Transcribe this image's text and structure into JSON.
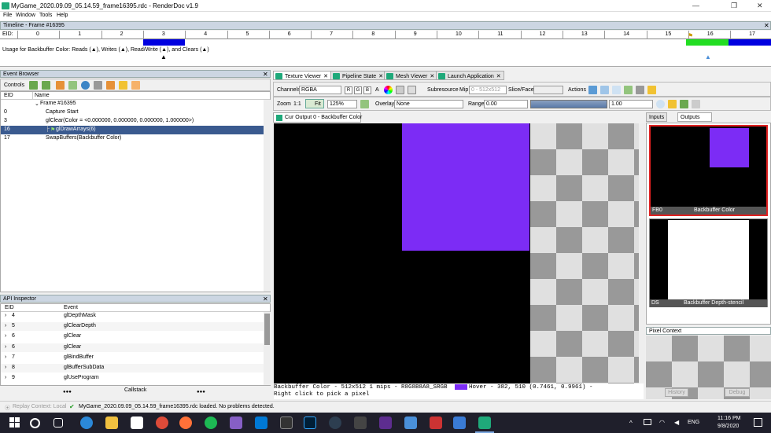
{
  "window": {
    "title": "MyGame_2020.09.09_05.14.59_frame16395.rdc - RenderDoc v1.9",
    "minimize": "—",
    "maximize": "❐",
    "close": "✕"
  },
  "menu": [
    "File",
    "Window",
    "Tools",
    "Help"
  ],
  "timeline": {
    "header": "Timeline - Frame #16395",
    "eid_label": "EID:",
    "ticks": [
      "0",
      "1",
      "2",
      "3",
      "4",
      "5",
      "6",
      "7",
      "8",
      "9",
      "10",
      "11",
      "12",
      "13",
      "14",
      "15",
      "16",
      "17"
    ],
    "usage": "Usage for Backbuffer Color: Reads (▲), Writes (▲), Read/Write (▲), and Clears (▲)"
  },
  "event_browser": {
    "header": "Event Browser",
    "controls_label": "Controls",
    "columns": [
      "EID",
      "Name"
    ],
    "rows": [
      {
        "eid": "",
        "name": "Frame #16395",
        "indent": 1
      },
      {
        "eid": "0",
        "name": "Capture Start",
        "indent": 2
      },
      {
        "eid": "3",
        "name": "glClear(Color = <0.000000, 0.000000, 0.000000, 1.000000>)",
        "indent": 2
      },
      {
        "eid": "16",
        "name": "glDrawArrays(6)",
        "indent": 2,
        "selected": true
      },
      {
        "eid": "17",
        "name": "SwapBuffers(Backbuffer Color)",
        "indent": 2
      }
    ]
  },
  "api_inspector": {
    "header": "API Inspector",
    "columns": [
      "EID",
      "Event"
    ],
    "rows": [
      {
        "eid": "4",
        "event": "glDepthMask"
      },
      {
        "eid": "5",
        "event": "glClearDepth"
      },
      {
        "eid": "6",
        "event": "glClear"
      },
      {
        "eid": "6",
        "event": "glClear"
      },
      {
        "eid": "7",
        "event": "glBindBuffer"
      },
      {
        "eid": "8",
        "event": "glBufferSubData"
      },
      {
        "eid": "9",
        "event": "glUseProgram"
      }
    ],
    "callstack_label": "Callstack",
    "dots": "●●●"
  },
  "tabs": [
    "Texture Viewer",
    "Pipeline State",
    "Mesh Viewer",
    "Launch Application"
  ],
  "texture_toolbar": {
    "channels_label": "Channels",
    "channels_value": "RGBA",
    "channel_buttons": [
      "R",
      "G",
      "B",
      "A"
    ],
    "subresource_label": "Subresource",
    "mip_label": "Mip",
    "mip_value": "0 - 512x512",
    "slice_label": "Slice/Face",
    "actions_label": "Actions",
    "zoom_label": "Zoom",
    "zoom_1to1": "1:1",
    "fit_label": "Fit",
    "zoom_value": "125%",
    "overlay_label": "Overlay",
    "overlay_value": "None",
    "range_label": "Range",
    "range_min": "0.00",
    "range_max": "1.00"
  },
  "output_tab": "Cur Output 0 - Backbuffer Color",
  "status_line": {
    "info": "Backbuffer Color - 512x512 1 mips - R8G8B8A8_SRGB",
    "hover": "Hover -    382,  510 (0.7461, 0.9961)   -",
    "hint": "Right click to pick a pixel"
  },
  "side_tabs": [
    "Inputs",
    "Outputs"
  ],
  "thumbnails": [
    {
      "slot": "FB0",
      "name": "Backbuffer Color"
    },
    {
      "slot": "DS",
      "name": "Backbuffer Depth-stencil"
    }
  ],
  "pixel_context": {
    "header": "Pixel Context",
    "history": "History",
    "debug": "Debug"
  },
  "statusbar": {
    "replay": "Replay Context: Local",
    "message": "MyGame_2020.09.09_05.14.59_frame16395.rdc loaded. No problems detected."
  },
  "taskbar": {
    "lang": "ENG",
    "time": "11:16 PM",
    "date": "9/8/2020"
  },
  "colors": {
    "purple": "#7c2cf5",
    "accent": "#1fa97a",
    "selected_row": "#3a5a8f"
  }
}
